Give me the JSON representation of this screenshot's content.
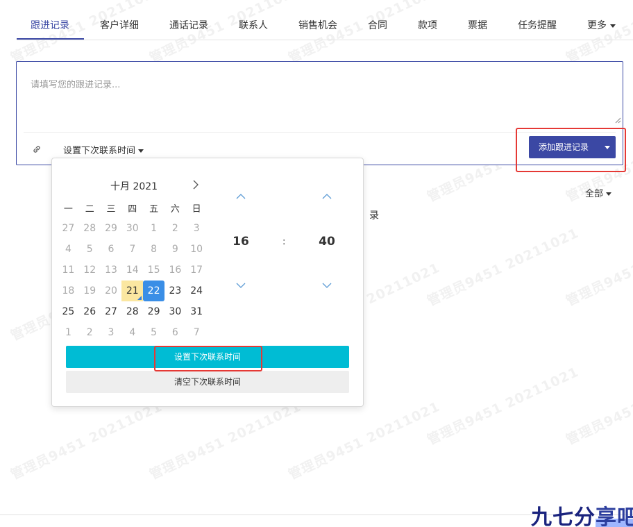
{
  "watermark": "管理员9451 20211021",
  "tabs": [
    {
      "label": "跟进记录",
      "active": true
    },
    {
      "label": "客户详细"
    },
    {
      "label": "通话记录"
    },
    {
      "label": "联系人"
    },
    {
      "label": "销售机会"
    },
    {
      "label": "合同"
    },
    {
      "label": "款项"
    },
    {
      "label": "票据"
    },
    {
      "label": "任务提醒"
    },
    {
      "label": "更多"
    }
  ],
  "editor": {
    "placeholder": "请填写您的跟进记录...",
    "next_contact_label": "设置下次联系时间",
    "add_button_label": "添加跟进记录"
  },
  "filter": {
    "label": "全部"
  },
  "empty_hint": "录",
  "datepicker": {
    "month_title": "十月 2021",
    "weekdays": [
      "一",
      "二",
      "三",
      "四",
      "五",
      "六",
      "日"
    ],
    "days": [
      {
        "d": "27",
        "m": true
      },
      {
        "d": "28",
        "m": true
      },
      {
        "d": "29",
        "m": true
      },
      {
        "d": "30",
        "m": true
      },
      {
        "d": "1",
        "m": true
      },
      {
        "d": "2",
        "m": true
      },
      {
        "d": "3",
        "m": true
      },
      {
        "d": "4",
        "m": true
      },
      {
        "d": "5",
        "m": true
      },
      {
        "d": "6",
        "m": true
      },
      {
        "d": "7",
        "m": true
      },
      {
        "d": "8",
        "m": true
      },
      {
        "d": "9",
        "m": true
      },
      {
        "d": "10",
        "m": true
      },
      {
        "d": "11",
        "m": true
      },
      {
        "d": "12",
        "m": true
      },
      {
        "d": "13",
        "m": true
      },
      {
        "d": "14",
        "m": true
      },
      {
        "d": "15",
        "m": true
      },
      {
        "d": "16",
        "m": true
      },
      {
        "d": "17",
        "m": true
      },
      {
        "d": "18",
        "m": true
      },
      {
        "d": "19",
        "m": true
      },
      {
        "d": "20",
        "m": true
      },
      {
        "d": "21",
        "today": true
      },
      {
        "d": "22",
        "selected": true
      },
      {
        "d": "23"
      },
      {
        "d": "24"
      },
      {
        "d": "25"
      },
      {
        "d": "26"
      },
      {
        "d": "27"
      },
      {
        "d": "28"
      },
      {
        "d": "29"
      },
      {
        "d": "30"
      },
      {
        "d": "31"
      },
      {
        "d": "1",
        "m": true
      },
      {
        "d": "2",
        "m": true
      },
      {
        "d": "3",
        "m": true
      },
      {
        "d": "4",
        "m": true
      },
      {
        "d": "5",
        "m": true
      },
      {
        "d": "6",
        "m": true
      },
      {
        "d": "7",
        "m": true
      }
    ],
    "hour": "16",
    "minute": "40",
    "separator": ":",
    "confirm_label": "设置下次联系时间",
    "clear_label": "清空下次联系时间"
  },
  "brand": {
    "text_a": "九七分",
    "text_b": "享吧"
  },
  "colors": {
    "primary": "#3b48a4",
    "cyan": "#00bcd4",
    "selected": "#3a8ee6",
    "today": "#fbe7a1",
    "highlight": "#e53935"
  }
}
